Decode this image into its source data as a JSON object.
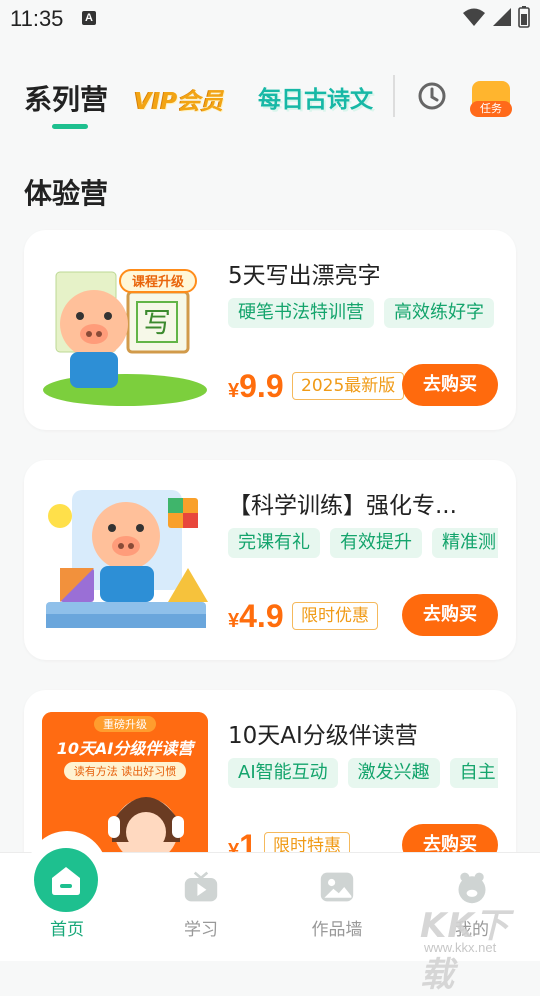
{
  "status_bar": {
    "time": "11:35",
    "app_icon_letter": "A"
  },
  "header": {
    "tab_active": "系列营",
    "vip_label": "VIP会员",
    "poem_label": "每日古诗文",
    "task_label": "任务",
    "accent_color": "#1ec08f"
  },
  "section_title": "体验营",
  "cards": [
    {
      "title": "5天写出漂亮字",
      "tags": [
        "硬笔书法特训营",
        "高效练好字"
      ],
      "currency": "¥",
      "price": "9.9",
      "badge": "2025最新版",
      "buy_label": "去购买",
      "thumb_badge": "课程升级",
      "thumb_char": "写"
    },
    {
      "title": "【科学训练】强化专...",
      "tags": [
        "完课有礼",
        "有效提升",
        "精准测"
      ],
      "currency": "¥",
      "price": "4.9",
      "badge": "限时优惠",
      "buy_label": "去购买"
    },
    {
      "title": "10天AI分级伴读营",
      "tags": [
        "AI智能互动",
        "激发兴趣",
        "自主"
      ],
      "currency": "¥",
      "price": "1",
      "badge": "限时特惠",
      "buy_label": "去购买",
      "thumb_top": "重磅升级",
      "thumb_title": "10天AI分级伴读营",
      "thumb_sub": "读有方法 读出好习惯"
    }
  ],
  "bottom_nav": [
    {
      "label": "首页",
      "icon": "home-icon",
      "active": true
    },
    {
      "label": "学习",
      "icon": "video-icon",
      "active": false
    },
    {
      "label": "作品墙",
      "icon": "gallery-icon",
      "active": false
    },
    {
      "label": "我的",
      "icon": "profile-icon",
      "active": false
    }
  ],
  "watermark": {
    "text": "KK下载",
    "url": "www.kkx.net"
  }
}
